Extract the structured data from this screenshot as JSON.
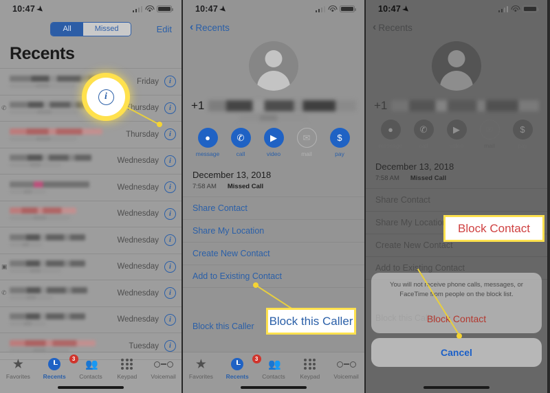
{
  "status_bar": {
    "time": "10:47",
    "location_icon": "location-arrow-icon",
    "signal_icon": "cellular-bars-icon",
    "wifi_icon": "wifi-icon",
    "battery_icon": "battery-icon"
  },
  "panel1": {
    "segmented": {
      "options": [
        "All",
        "Missed"
      ],
      "selected": "All"
    },
    "edit_label": "Edit",
    "title": "Recents",
    "rows": [
      {
        "day": "Friday",
        "missed": false,
        "type_icon": ""
      },
      {
        "day": "Thursday",
        "missed": false,
        "type_icon": "phone-outgoing-icon"
      },
      {
        "day": "Thursday",
        "missed": true,
        "type_icon": ""
      },
      {
        "day": "Wednesday",
        "missed": false,
        "type_icon": ""
      },
      {
        "day": "Wednesday",
        "missed": false,
        "type_icon": ""
      },
      {
        "day": "Wednesday",
        "missed": true,
        "type_icon": ""
      },
      {
        "day": "Wednesday",
        "missed": false,
        "type_icon": ""
      },
      {
        "day": "Wednesday",
        "missed": false,
        "type_icon": "video-icon"
      },
      {
        "day": "Wednesday",
        "missed": false,
        "type_icon": "phone-outgoing-icon"
      },
      {
        "day": "Wednesday",
        "missed": false,
        "type_icon": ""
      },
      {
        "day": "Tuesday",
        "missed": true,
        "type_icon": ""
      }
    ],
    "info_icon": "info-circle-icon"
  },
  "tabbar": {
    "items": [
      {
        "label": "Favorites",
        "icon": "star-icon",
        "active": false,
        "badge": ""
      },
      {
        "label": "Recents",
        "icon": "clock-icon",
        "active": true,
        "badge": "3"
      },
      {
        "label": "Contacts",
        "icon": "contacts-icon",
        "active": false,
        "badge": ""
      },
      {
        "label": "Keypad",
        "icon": "keypad-icon",
        "active": false,
        "badge": ""
      },
      {
        "label": "Voicemail",
        "icon": "voicemail-icon",
        "active": false,
        "badge": ""
      }
    ]
  },
  "detail": {
    "back_label": "Recents",
    "back_icon": "chevron-left-icon",
    "avatar_icon": "person-placeholder-avatar",
    "phone_prefix": "+1",
    "actions": [
      {
        "label": "message",
        "icon": "message-bubble-icon",
        "disabled": false,
        "glyph": "●"
      },
      {
        "label": "call",
        "icon": "phone-icon",
        "disabled": false,
        "glyph": "✆"
      },
      {
        "label": "video",
        "icon": "video-camera-icon",
        "disabled": false,
        "glyph": "▶"
      },
      {
        "label": "mail",
        "icon": "mail-envelope-icon",
        "disabled": true,
        "glyph": "✉"
      },
      {
        "label": "pay",
        "icon": "apple-pay-icon",
        "disabled": false,
        "glyph": "$"
      }
    ],
    "date": "December 13, 2018",
    "time": "7:58 AM",
    "call_kind": "Missed Call",
    "links": [
      "Share Contact",
      "Share My Location",
      "Create New Contact",
      "Add to Existing Contact"
    ],
    "block_link": "Block this Caller"
  },
  "action_sheet": {
    "message": "You will not receive phone calls, messages, or FaceTime from people on the block list.",
    "block_label": "Block Contact",
    "cancel_label": "Cancel"
  },
  "annotations": {
    "callout_block_caller": "Block this Caller",
    "callout_block_contact": "Block Contact",
    "highlight_icon": "info-circle-icon"
  },
  "colors": {
    "accent_blue": "#2a5fa8",
    "highlight_yellow": "#ffe14d",
    "danger_red": "#cf4040",
    "badge_red": "#d0342c"
  }
}
